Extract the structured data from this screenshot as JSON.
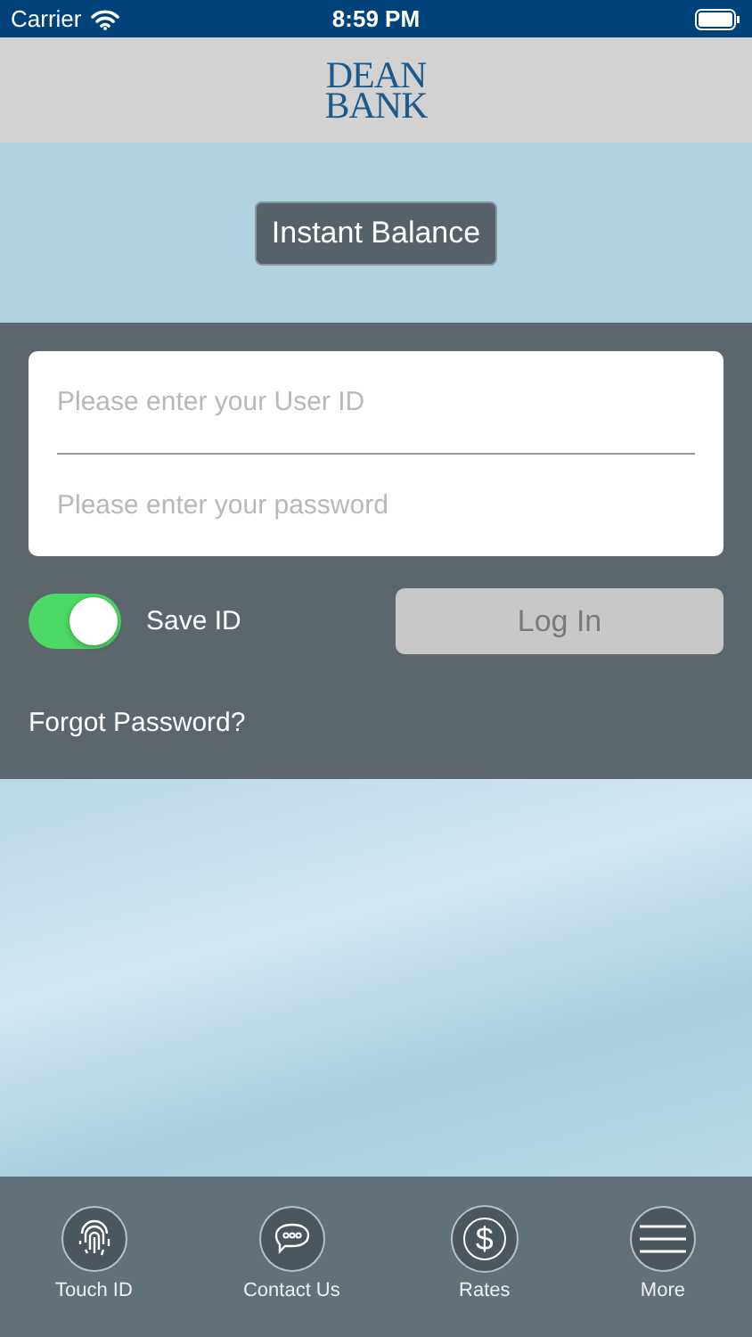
{
  "status_bar": {
    "carrier": "Carrier",
    "time": "8:59 PM"
  },
  "header": {
    "logo_lines": [
      "DEAN",
      "BANK"
    ]
  },
  "instant_balance": {
    "label": "Instant Balance"
  },
  "login": {
    "user_id": {
      "placeholder": "Please enter your User ID"
    },
    "password": {
      "placeholder": "Please enter your password"
    },
    "save_id": {
      "label": "Save ID",
      "on": true
    },
    "login_button": {
      "label": "Log In",
      "disabled": true
    },
    "forgot_link": "Forgot Password?"
  },
  "tab_bar": [
    {
      "kind": "fingerprint",
      "label": "Touch ID"
    },
    {
      "kind": "chat",
      "label": "Contact Us"
    },
    {
      "kind": "dollar",
      "label": "Rates",
      "glyph": "$"
    },
    {
      "kind": "menu",
      "label": "More"
    }
  ]
}
